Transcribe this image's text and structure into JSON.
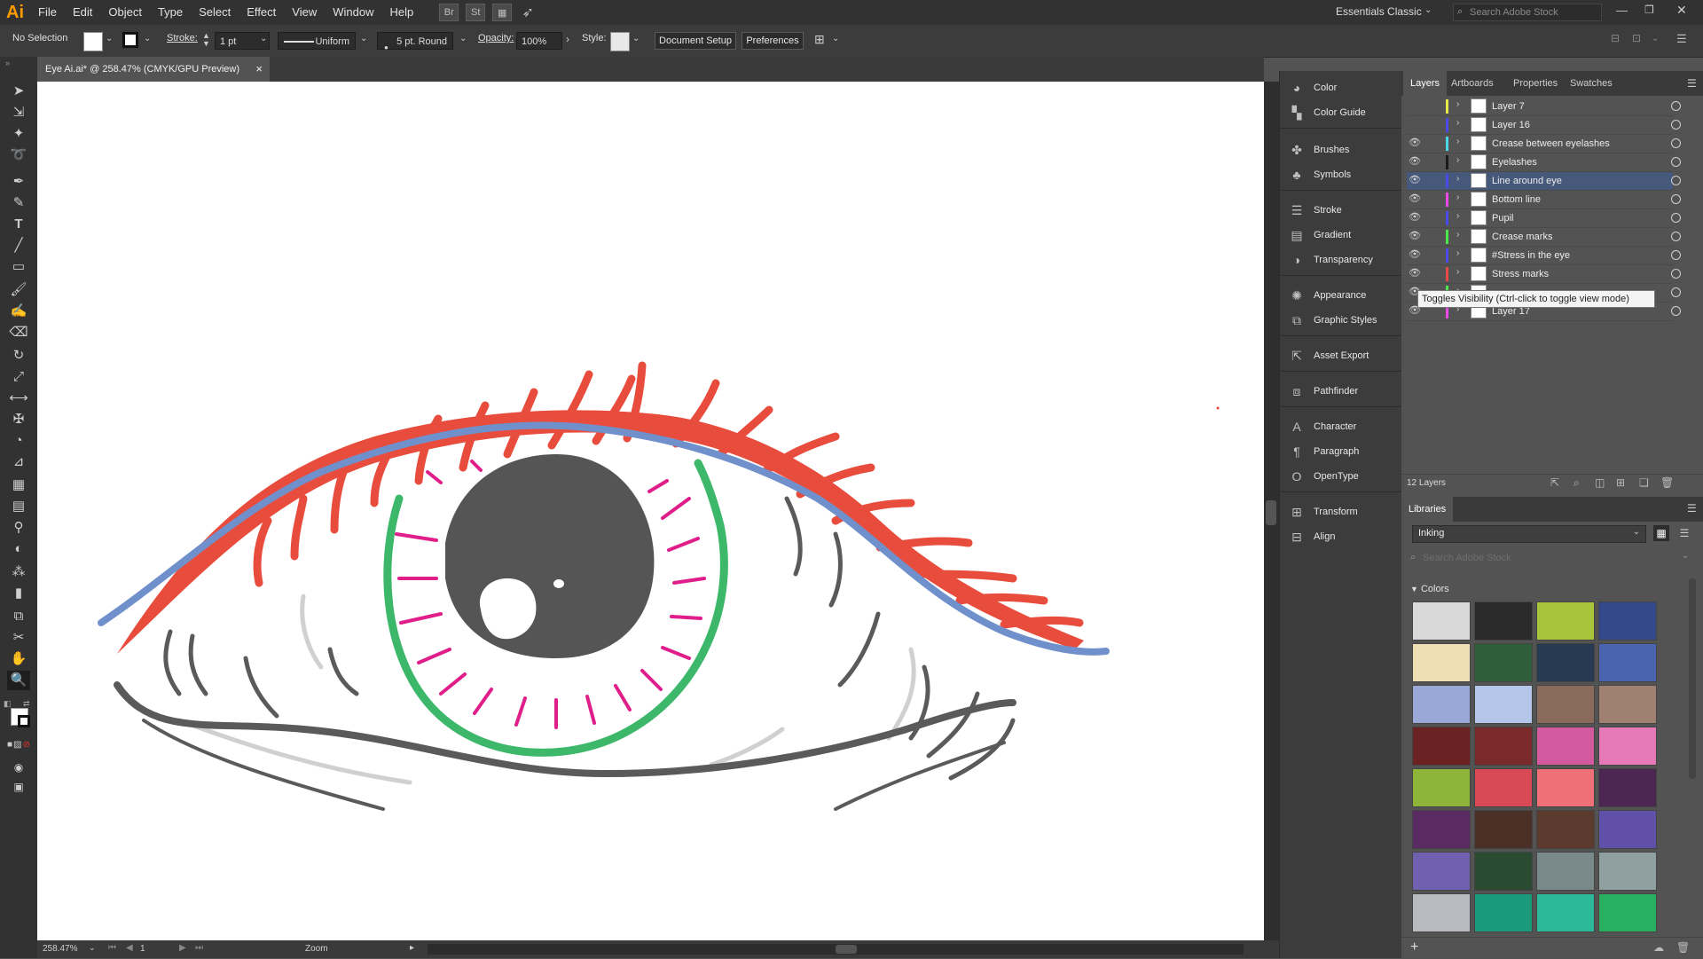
{
  "app": {
    "logo": "Ai",
    "menus": [
      "File",
      "Edit",
      "Object",
      "Type",
      "Select",
      "Effect",
      "View",
      "Window",
      "Help"
    ],
    "bridge_btn": "Br",
    "stock_btn": "St",
    "workspace": "Essentials Classic",
    "search_placeholder": "Search Adobe Stock"
  },
  "control_bar": {
    "selection": "No Selection",
    "stroke_label": "Stroke:",
    "stroke_value": "1 pt",
    "stroke_profile": "Uniform",
    "brush": "5 pt. Round",
    "opacity_label": "Opacity:",
    "opacity_value": "100%",
    "style_label": "Style:",
    "doc_setup": "Document Setup",
    "preferences": "Preferences"
  },
  "document": {
    "tab_title": "Eye Ai.ai* @ 258.47% (CMYK/GPU Preview)",
    "close": "×"
  },
  "status": {
    "zoom": "258.47%",
    "artboard": "1",
    "tool": "Zoom"
  },
  "mid_panel": {
    "items": [
      "Color",
      "Color Guide",
      "Brushes",
      "Symbols",
      "Stroke",
      "Gradient",
      "Transparency",
      "Appearance",
      "Graphic Styles",
      "Asset Export",
      "Pathfinder",
      "Character",
      "Paragraph",
      "OpenType",
      "Transform",
      "Align"
    ]
  },
  "layers_panel": {
    "tabs": [
      "Layers",
      "Artboards",
      "Properties",
      "Swatches"
    ],
    "rows": [
      {
        "name": "Layer 7",
        "color": "#e8e84a",
        "visible": false
      },
      {
        "name": "Layer 16",
        "color": "#4a4ae8",
        "visible": false
      },
      {
        "name": "Crease between eyelashes",
        "color": "#4ad8e8",
        "visible": true
      },
      {
        "name": "Eyelashes",
        "color": "#1a1a1a",
        "visible": true
      },
      {
        "name": "Line around eye",
        "color": "#4a4ae8",
        "visible": true
      },
      {
        "name": "Bottom line",
        "color": "#e84ae8",
        "visible": true
      },
      {
        "name": "Pupil",
        "color": "#4a4ae8",
        "visible": true
      },
      {
        "name": "Crease marks",
        "color": "#4ae84a",
        "visible": true
      },
      {
        "name": "#Stress in the eye",
        "color": "#4a4ae8",
        "visible": true
      },
      {
        "name": "Stress marks",
        "color": "#e84a4a",
        "visible": true
      },
      {
        "name": "",
        "color": "#4ae84a",
        "visible": true
      },
      {
        "name": "Layer 17",
        "color": "#e84ae8",
        "visible": true
      }
    ],
    "tooltip": "Toggles Visibility (Ctrl-click to toggle view mode)",
    "count": "12 Layers"
  },
  "libraries": {
    "title": "Libraries",
    "library_name": "Inking",
    "search_placeholder": "Search Adobe Stock",
    "colors_label": "Colors",
    "swatches": [
      "#d9d9d9",
      "#2b2b2b",
      "#a8c43a",
      "#34498a",
      "#f0dfb4",
      "#2f5e3a",
      "#273a52",
      "#4a64b0",
      "#9aa8d8",
      "#b4c6ea",
      "#8a6a5a",
      "#a08070",
      "#6a2222",
      "#7a2a2a",
      "#d45aa0",
      "#e67ab8",
      "#8fb43a",
      "#d84a55",
      "#f07078",
      "#4a2650",
      "#5a2a62",
      "#4a3026",
      "#5c3a2e",
      "#6050a8",
      "#7060b0",
      "#2a4a32",
      "#7a8a8a",
      "#90a0a0",
      "#b8bcc0",
      "#1a9a7a",
      "#2ab898",
      "#28b060"
    ]
  }
}
